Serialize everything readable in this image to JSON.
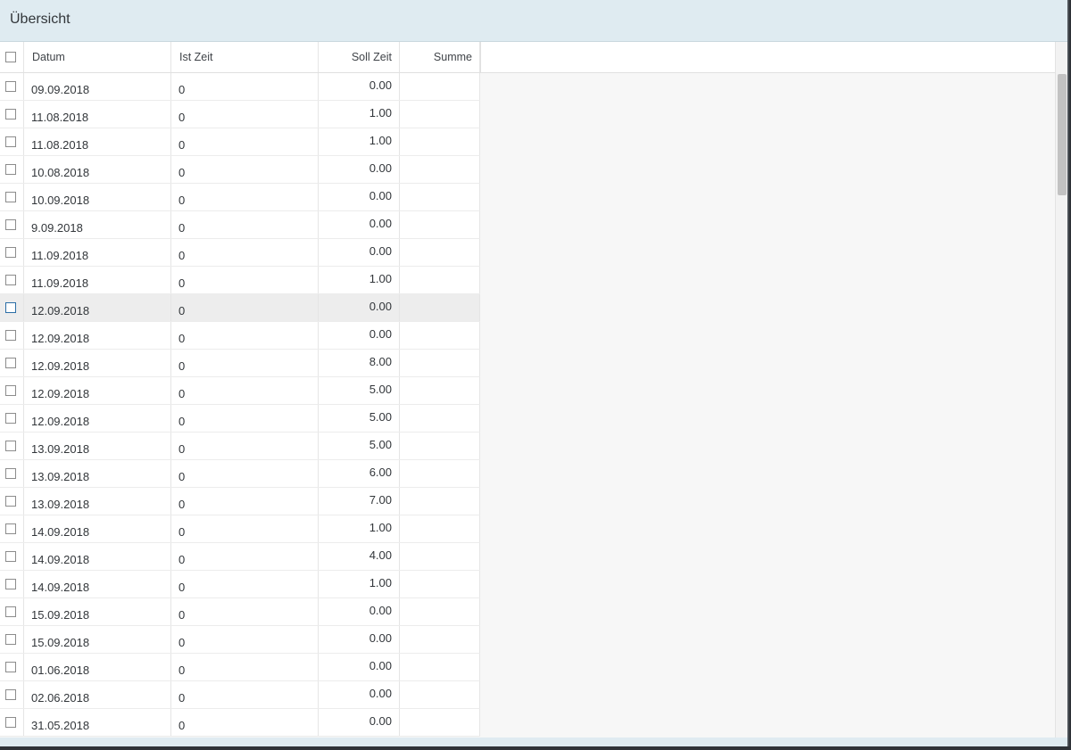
{
  "window": {
    "title": "Übersicht"
  },
  "table": {
    "columns": [
      "Datum",
      "Ist Zeit",
      "Soll Zeit",
      "Summe"
    ],
    "rows": [
      {
        "datum": "09.09.2018",
        "ist": "0",
        "soll": "0.00",
        "summe": ""
      },
      {
        "datum": "11.08.2018",
        "ist": "0",
        "soll": "1.00",
        "summe": ""
      },
      {
        "datum": "11.08.2018",
        "ist": "0",
        "soll": "1.00",
        "summe": ""
      },
      {
        "datum": "10.08.2018",
        "ist": "0",
        "soll": "0.00",
        "summe": ""
      },
      {
        "datum": "10.09.2018",
        "ist": "0",
        "soll": "0.00",
        "summe": ""
      },
      {
        "datum": "9.09.2018",
        "ist": "0",
        "soll": "0.00",
        "summe": ""
      },
      {
        "datum": "11.09.2018",
        "ist": "0",
        "soll": "0.00",
        "summe": ""
      },
      {
        "datum": "11.09.2018",
        "ist": "0",
        "soll": "1.00",
        "summe": ""
      },
      {
        "datum": "12.09.2018",
        "ist": "0",
        "soll": "0.00",
        "summe": ""
      },
      {
        "datum": "12.09.2018",
        "ist": "0",
        "soll": "0.00",
        "summe": ""
      },
      {
        "datum": "12.09.2018",
        "ist": "0",
        "soll": "8.00",
        "summe": ""
      },
      {
        "datum": "12.09.2018",
        "ist": "0",
        "soll": "5.00",
        "summe": ""
      },
      {
        "datum": "12.09.2018",
        "ist": "0",
        "soll": "5.00",
        "summe": ""
      },
      {
        "datum": "13.09.2018",
        "ist": "0",
        "soll": "5.00",
        "summe": ""
      },
      {
        "datum": "13.09.2018",
        "ist": "0",
        "soll": "6.00",
        "summe": ""
      },
      {
        "datum": "13.09.2018",
        "ist": "0",
        "soll": "7.00",
        "summe": ""
      },
      {
        "datum": "14.09.2018",
        "ist": "0",
        "soll": "1.00",
        "summe": ""
      },
      {
        "datum": "14.09.2018",
        "ist": "0",
        "soll": "4.00",
        "summe": ""
      },
      {
        "datum": "14.09.2018",
        "ist": "0",
        "soll": "1.00",
        "summe": ""
      },
      {
        "datum": "15.09.2018",
        "ist": "0",
        "soll": "0.00",
        "summe": ""
      },
      {
        "datum": "15.09.2018",
        "ist": "0",
        "soll": "0.00",
        "summe": ""
      },
      {
        "datum": "01.06.2018",
        "ist": "0",
        "soll": "0.00",
        "summe": ""
      },
      {
        "datum": "02.06.2018",
        "ist": "0",
        "soll": "0.00",
        "summe": ""
      },
      {
        "datum": "31.05.2018",
        "ist": "0",
        "soll": "0.00",
        "summe": ""
      }
    ],
    "hovered_row": 8
  },
  "colors": {
    "title_bar": "#dfebf1",
    "hover_row": "#ededed",
    "checkbox_focus": "#2b6ea6"
  }
}
